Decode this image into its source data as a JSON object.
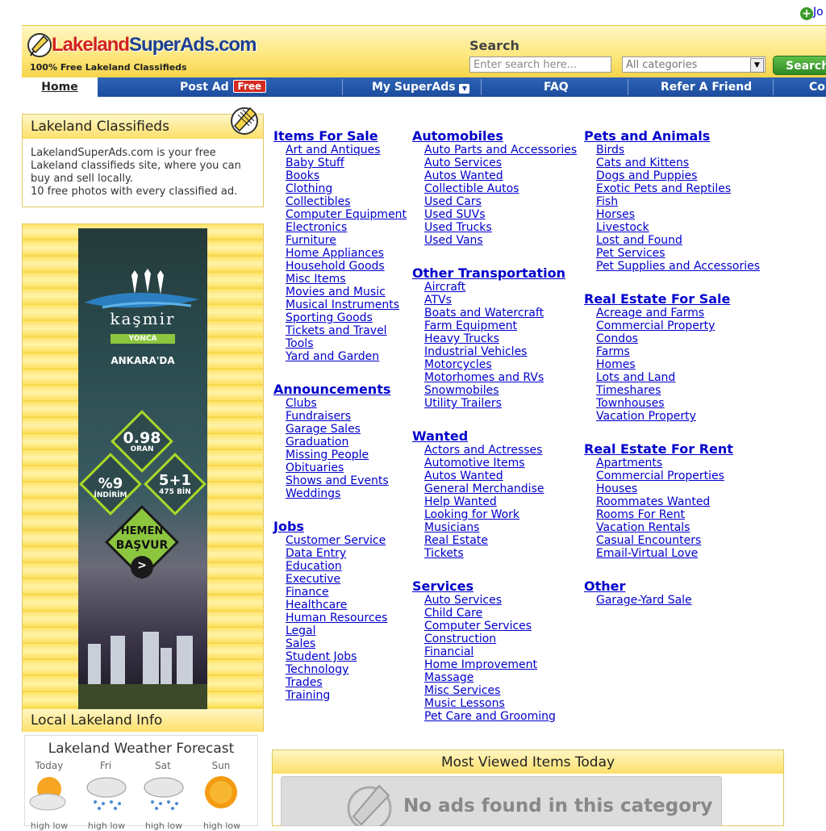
{
  "header": {
    "join_label": "Jo",
    "logo": {
      "part1": "Lakeland",
      "part2": "SuperAds.com"
    },
    "tagline": "100% Free Lakeland Classifieds",
    "search": {
      "label": "Search",
      "placeholder": "Enter search here...",
      "category_selected": "All categories",
      "button": "Search"
    }
  },
  "nav": {
    "home": "Home",
    "post_ad": "Post Ad",
    "post_ad_badge": "Free",
    "my_superads": "My SuperAds",
    "faq": "FAQ",
    "refer": "Refer A Friend",
    "contact": "Co"
  },
  "sidebar": {
    "classifieds_title": "Lakeland Classifieds",
    "classifieds_text": [
      "LakelandSuperAds.com is your free",
      "Lakeland classifieds site, where you can",
      "buy and sell locally.",
      "10 free photos with every classified ad."
    ],
    "ad": {
      "brand": "kaşmir",
      "brand_sub": "YONCA",
      "city": "ANKARA'DA",
      "badge1_big": "0.98",
      "badge1_small": "ORAN",
      "badge2_big": "%9",
      "badge2_small": "İNDİRİM",
      "badge3_big": "5+1",
      "badge3_small": "475 BİN",
      "cta_line1": "HEMEN",
      "cta_line2": "BAŞVUR",
      "cta_arrow": ">"
    },
    "local_title": "Local Lakeland Info",
    "weather": {
      "title": "Lakeland Weather Forecast",
      "days": [
        {
          "label": "Today",
          "icon": "partly-sunny-icon",
          "lows": "high  low"
        },
        {
          "label": "Fri",
          "icon": "rain-cloud-icon",
          "lows": "high  low"
        },
        {
          "label": "Sat",
          "icon": "rain-cloud-icon",
          "lows": "high  low"
        },
        {
          "label": "Sun",
          "icon": "sun-icon",
          "lows": "high  low"
        }
      ]
    }
  },
  "categories": {
    "col1": [
      {
        "title": "Items For Sale",
        "items": [
          "Art and Antiques",
          "Baby Stuff",
          "Books",
          "Clothing",
          "Collectibles",
          "Computer Equipment",
          "Electronics",
          "Furniture",
          "Home Appliances",
          "Household Goods",
          "Misc Items",
          "Movies and Music",
          "Musical Instruments",
          "Sporting Goods",
          "Tickets and Travel",
          "Tools",
          "Yard and Garden"
        ]
      },
      {
        "title": "Announcements",
        "items": [
          "Clubs",
          "Fundraisers",
          "Garage Sales",
          "Graduation",
          "Missing People",
          "Obituaries",
          "Shows and Events",
          "Weddings"
        ]
      },
      {
        "title": "Jobs",
        "items": [
          "Customer Service",
          "Data Entry",
          "Education",
          "Executive",
          "Finance",
          "Healthcare",
          "Human Resources",
          "Legal",
          "Sales",
          "Student Jobs",
          "Technology",
          "Trades",
          "Training"
        ]
      }
    ],
    "col2": [
      {
        "title": "Automobiles",
        "items": [
          "Auto Parts and Accessories",
          "Auto Services",
          "Autos Wanted",
          "Collectible Autos",
          "Used Cars",
          "Used SUVs",
          "Used Trucks",
          "Used Vans"
        ]
      },
      {
        "title": "Other Transportation",
        "items": [
          "Aircraft",
          "ATVs",
          "Boats and Watercraft",
          "Farm Equipment",
          "Heavy Trucks",
          "Industrial Vehicles",
          "Motorcycles",
          "Motorhomes and RVs",
          "Snowmobiles",
          "Utility Trailers"
        ]
      },
      {
        "title": "Wanted",
        "items": [
          "Actors and Actresses",
          "Automotive Items",
          "Autos Wanted",
          "General Merchandise",
          "Help Wanted",
          "Looking for Work",
          "Musicians",
          "Real Estate",
          "Tickets"
        ]
      },
      {
        "title": "Services",
        "items": [
          "Auto Services",
          "Child Care",
          "Computer Services",
          "Construction",
          "Financial",
          "Home Improvement",
          "Massage",
          "Misc Services",
          "Music Lessons",
          "Pet Care and Grooming"
        ]
      }
    ],
    "col3": [
      {
        "title": "Pets and Animals",
        "items": [
          "Birds",
          "Cats and Kittens",
          "Dogs and Puppies",
          "Exotic Pets and Reptiles",
          "Fish",
          "Horses",
          "Livestock",
          "Lost and Found",
          "Pet Services",
          "Pet Supplies and Accessories"
        ]
      },
      {
        "title": "Real Estate For Sale",
        "items": [
          "Acreage and Farms",
          "Commercial Property",
          "Condos",
          "Farms",
          "Homes",
          "Lots and Land",
          "Timeshares",
          "Townhouses",
          "Vacation Property"
        ]
      },
      {
        "title": "Real Estate For Rent",
        "items": [
          "Apartments",
          "Commercial Properties",
          "Houses",
          "Roommates Wanted",
          "Rooms For Rent",
          "Vacation Rentals",
          "Casual Encounters",
          "Email-Virtual Love"
        ]
      },
      {
        "title": "Other",
        "items": [
          "Garage-Yard Sale"
        ]
      }
    ]
  },
  "most_viewed": {
    "title": "Most Viewed Items Today",
    "empty_text": "No ads found in this category"
  },
  "colors": {
    "nav_blue": "#1c4c9e",
    "header_yellow": "#fde67a",
    "link": "#0000cc",
    "logo_red": "#d2231f",
    "logo_blue": "#1d3f8f",
    "search_green": "#2f8a23"
  }
}
